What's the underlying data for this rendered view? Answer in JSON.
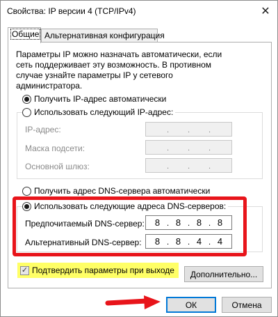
{
  "window": {
    "title": "Свойства: IP версии 4 (TCP/IPv4)",
    "close_glyph": "✕"
  },
  "tabs": [
    {
      "label": "Общие",
      "active": true
    },
    {
      "label": "Альтернативная конфигурация",
      "active": false
    }
  ],
  "description": "Параметры IP можно назначать автоматически, если сеть поддерживает эту возможность. В противном случае узнайте параметры IP у сетевого администратора.",
  "ip_section": {
    "auto_label": "Получить IP-адрес автоматически",
    "auto_selected": true,
    "manual_label": "Использовать следующий IP-адрес:",
    "manual_selected": false,
    "fields": [
      {
        "label": "IP-адрес:",
        "octets": [
          "",
          "",
          "",
          ""
        ]
      },
      {
        "label": "Маска подсети:",
        "octets": [
          "",
          "",
          "",
          ""
        ]
      },
      {
        "label": "Основной шлюз:",
        "octets": [
          "",
          "",
          "",
          ""
        ]
      }
    ]
  },
  "dns_section": {
    "auto_label": "Получить адрес DNS-сервера автоматически",
    "auto_selected": false,
    "manual_label": "Использовать следующие адреса DNS-серверов:",
    "manual_selected": true,
    "preferred": {
      "label": "Предпочитаемый DNS-сервер:",
      "octets": [
        "8",
        "8",
        "8",
        "8"
      ]
    },
    "alternate": {
      "label": "Альтернативный DNS-сервер:",
      "octets": [
        "8",
        "8",
        "4",
        "4"
      ]
    }
  },
  "validate": {
    "label": "Подтвердить параметры при выходе",
    "checked": true,
    "check_glyph": "✓"
  },
  "buttons": {
    "advanced": "Дополнительно...",
    "ok": "ОК",
    "cancel": "Отмена"
  },
  "colors": {
    "highlight_frame": "#e8141a",
    "checkbox_highlight": "#ffff66",
    "default_button_border": "#0078d7"
  }
}
